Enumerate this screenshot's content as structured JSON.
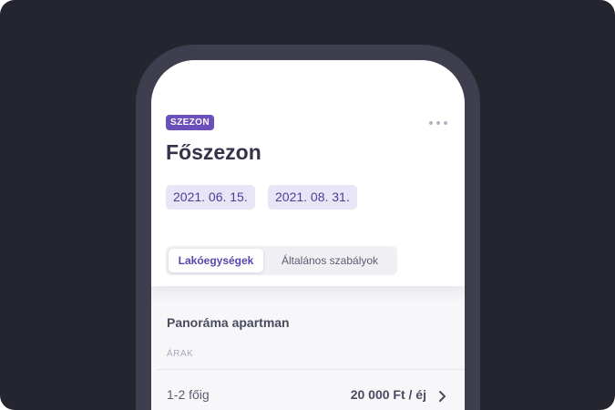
{
  "season": {
    "badge": "SZEZON",
    "title": "Főszezon",
    "start_date": "2021. 06. 15.",
    "end_date": "2021. 08. 31."
  },
  "tabs": [
    {
      "label": "Lakóegységek",
      "active": true
    },
    {
      "label": "Általános szabályok",
      "active": false
    }
  ],
  "unit": {
    "name": "Panoráma apartman",
    "section_label": "ÁRAK",
    "prices": [
      {
        "label": "1-2 főig",
        "value": "20 000 Ft / éj"
      }
    ]
  },
  "colors": {
    "background": "#25252f",
    "device_frame": "#3e3e4f",
    "accent": "#6b4fbb",
    "chip_bg": "#e8e5f7"
  },
  "icons": {
    "more": "more-horizontal-icon",
    "row_arrow": "chevron-right-icon"
  }
}
